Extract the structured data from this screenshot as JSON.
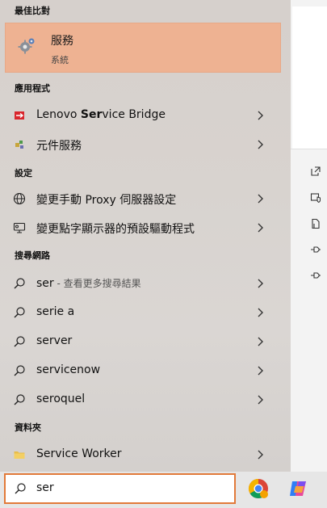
{
  "sections": {
    "best_match": "最佳比對",
    "apps": "應用程式",
    "settings": "設定",
    "web": "搜尋網路",
    "folders": "資料夾"
  },
  "best_match": {
    "title": "服務",
    "subtitle": "系統",
    "icon": "gear-services-icon"
  },
  "apps": [
    {
      "label_pre": "Lenovo ",
      "label_bold": "Ser",
      "label_post": "vice Bridge",
      "icon": "lenovo-icon"
    },
    {
      "label": "元件服務",
      "icon": "component-services-icon"
    }
  ],
  "settings": [
    {
      "label": "變更手動 Proxy 伺服器設定",
      "icon": "globe-icon"
    },
    {
      "label": "變更點字顯示器的預設驅動程式",
      "icon": "braille-display-icon"
    }
  ],
  "web": [
    {
      "label": "ser",
      "hint": " - 查看更多搜尋結果",
      "icon": "search-icon"
    },
    {
      "label": "serie a",
      "icon": "search-icon"
    },
    {
      "label": "server",
      "icon": "search-icon"
    },
    {
      "label": "servicenow",
      "icon": "search-icon"
    },
    {
      "label": "seroquel",
      "icon": "search-icon"
    }
  ],
  "folders": [
    {
      "label": "Service Worker",
      "icon": "folder-icon"
    }
  ],
  "search": {
    "value": "ser"
  },
  "colors": {
    "highlight": "#eeb292",
    "search_border": "#e27a3a"
  }
}
